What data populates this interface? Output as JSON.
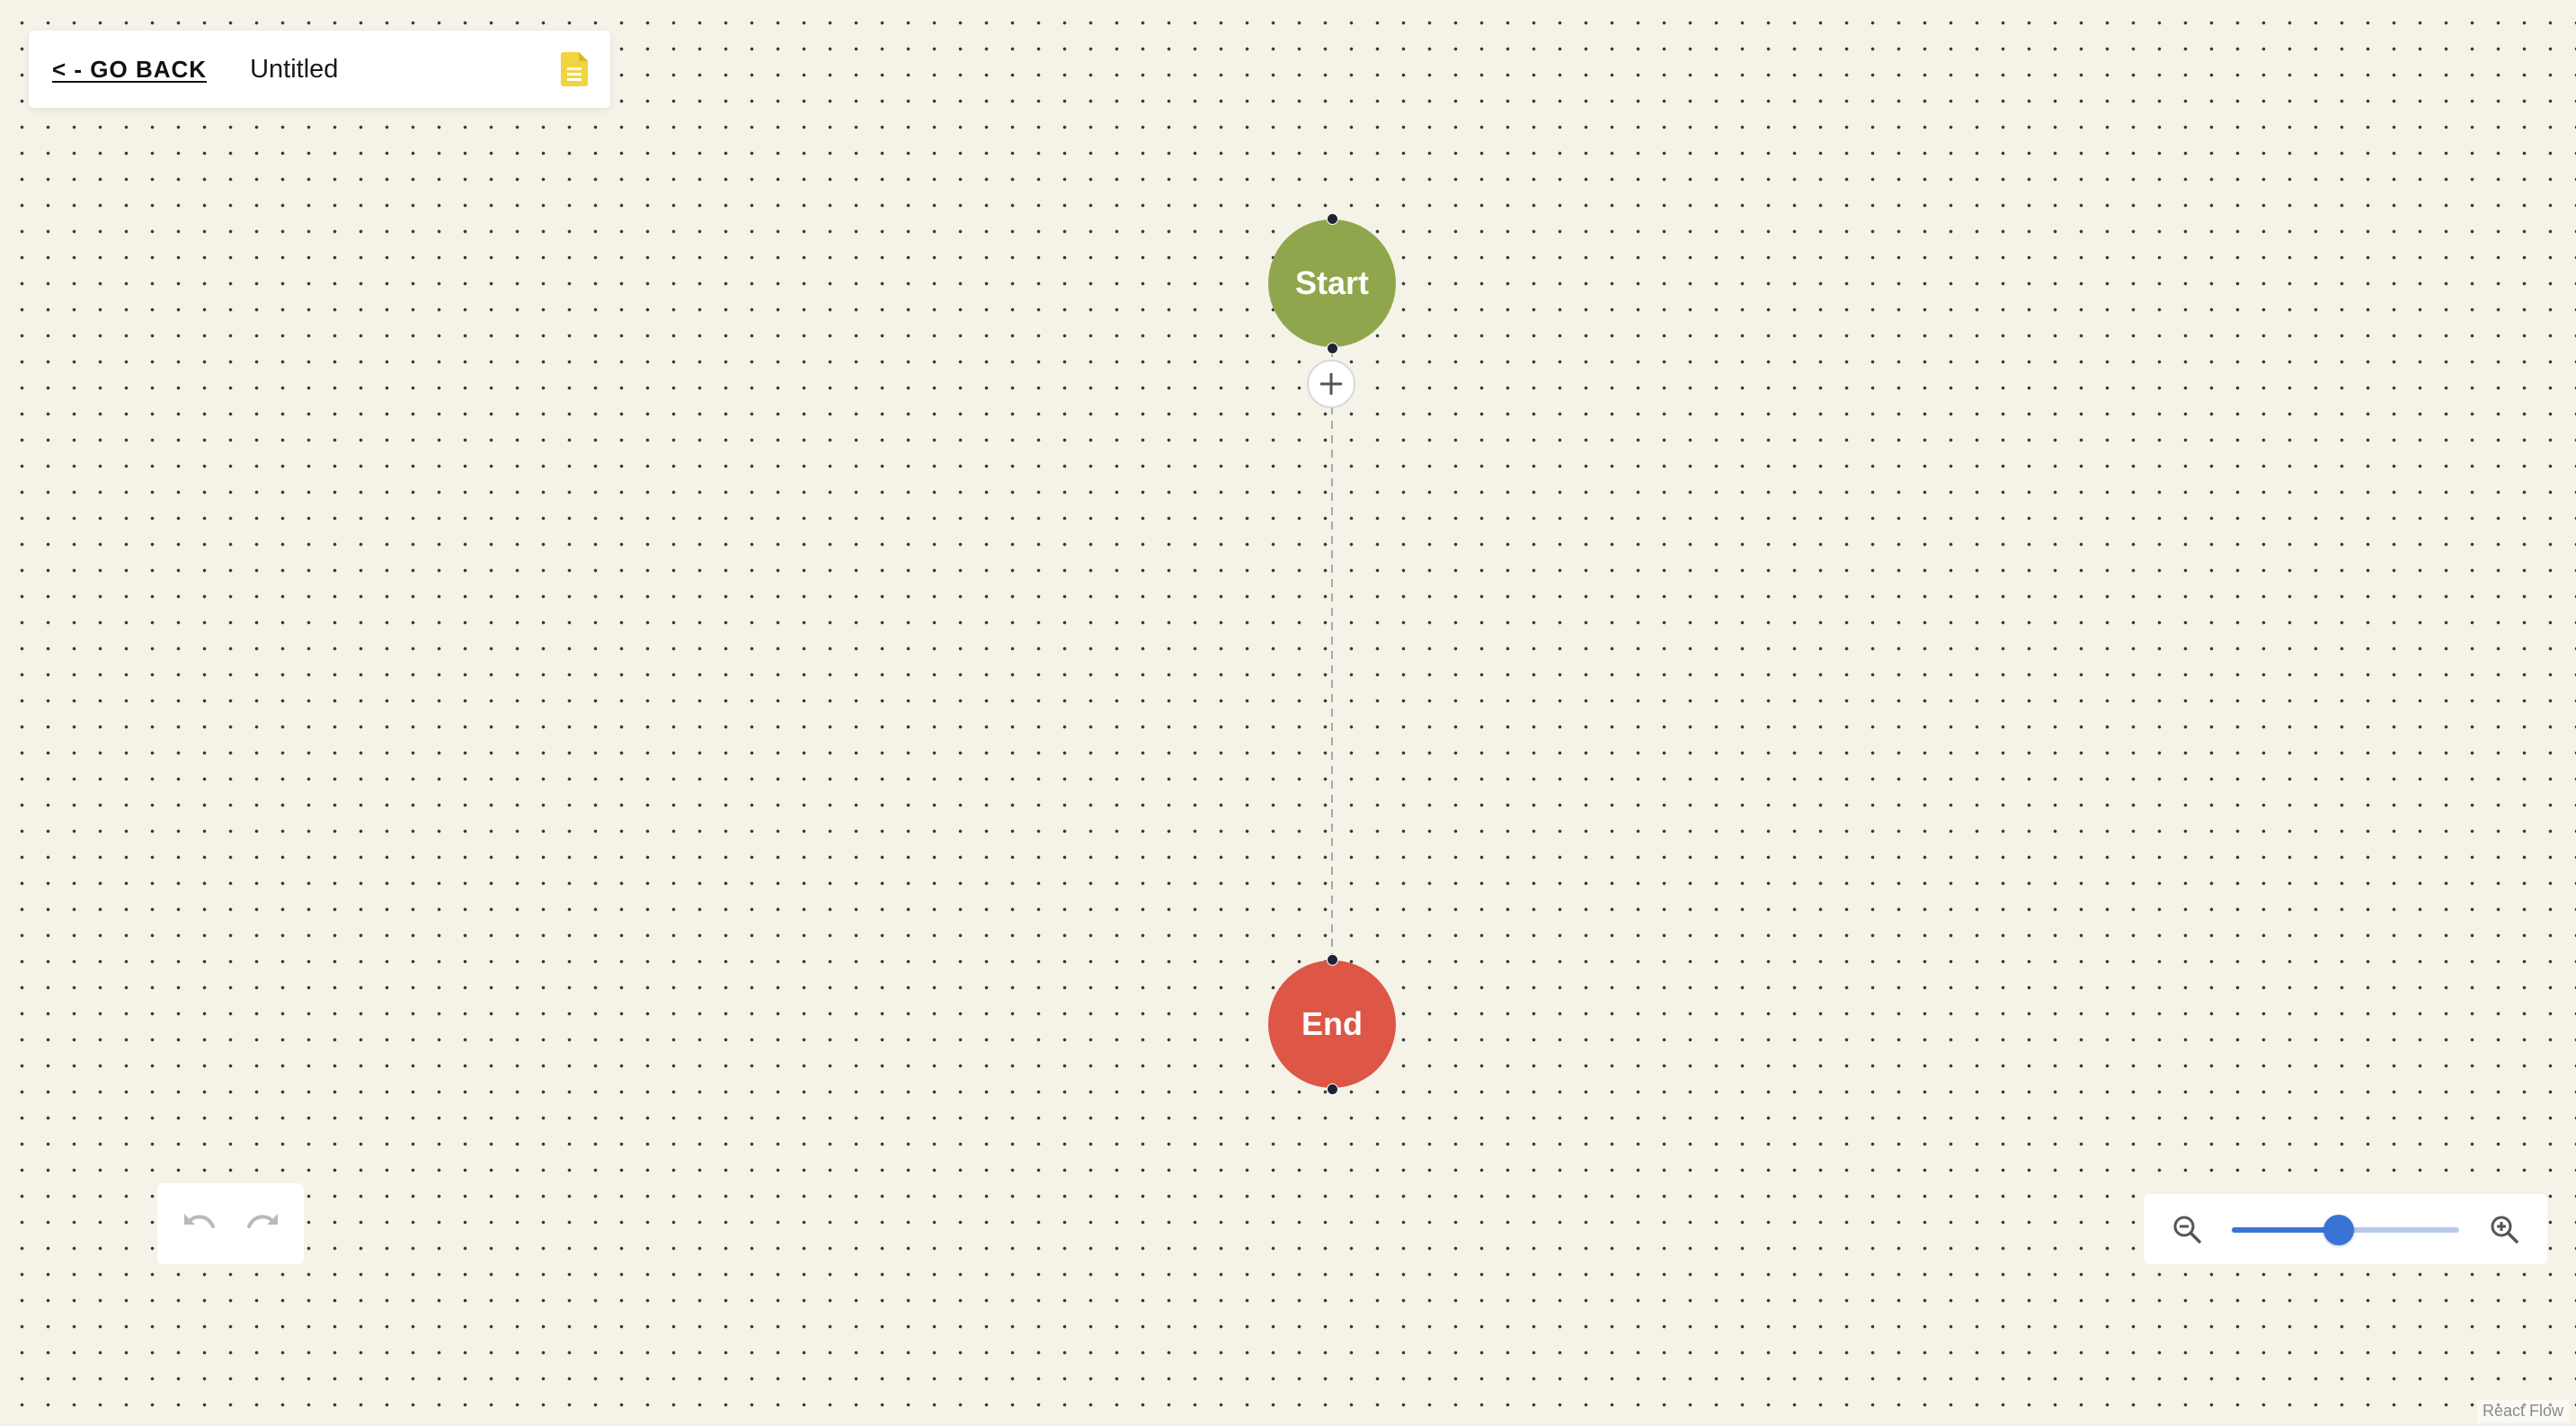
{
  "header": {
    "back_label": "< - GO BACK",
    "title": "Untitled",
    "doc_icon": "document-icon"
  },
  "flow": {
    "nodes": [
      {
        "id": "start",
        "label": "Start",
        "color": "#8fa64c"
      },
      {
        "id": "end",
        "label": "End",
        "color": "#dd5646"
      }
    ],
    "edge": {
      "style": "dashed",
      "from": "start",
      "to": "end"
    },
    "add_button_icon": "plus-icon"
  },
  "history": {
    "undo_icon": "undo-icon",
    "redo_icon": "redo-icon"
  },
  "zoom": {
    "zoom_out_icon": "zoom-out-icon",
    "zoom_in_icon": "zoom-in-icon",
    "level_fraction": 0.47,
    "accent_color": "#3a73d6"
  },
  "attribution": "React Flow"
}
